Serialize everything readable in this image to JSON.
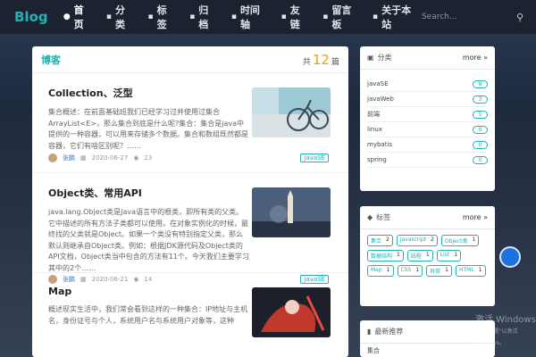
{
  "nav": {
    "logo": "Blog",
    "items": [
      {
        "label": "首页",
        "active": true
      },
      {
        "label": "分类"
      },
      {
        "label": "标签"
      },
      {
        "label": "归档"
      },
      {
        "label": "时间轴"
      },
      {
        "label": "友链"
      },
      {
        "label": "留言板"
      },
      {
        "label": "关于本站"
      }
    ],
    "search_placeholder": "Search..."
  },
  "main": {
    "title": "博客",
    "count_prefix": "共",
    "count": "12",
    "count_suffix": "篇",
    "articles": [
      {
        "title": "Collection、泛型",
        "desc": "集合概述：在前面基础班我们已经学习过并使用过集合ArrayList<E>，那么集合到底是什么呢?集合：集合是java中提供的一种容器，可以用来存储多个数据。集合和数组既然都是容器，它们有啥区别呢？……",
        "author": "张鹏",
        "date": "2020-06-27",
        "views": "23",
        "tag": "javaSE"
      },
      {
        "title": "Object类、常用API",
        "desc": "java.lang.Object类是Java语言中的根类，即所有类的父类。它中描述的所有方法子类都可以使用。在对象实例化的时候，最终找的父类就是Object。如果一个类没有特别指定父类，那么默认则继承自Object类。例如：根据JDK源代码及Object类的API文档，Object类当中包含的方法有11个。今天我们主要学习其中的2个……",
        "author": "张鹏",
        "date": "2020-06-21",
        "views": "14",
        "tag": "javaSE"
      },
      {
        "title": "Map",
        "desc": "概述现实生活中，我们常会看到这样的一种集合：IP地址与主机名，身份证号与个人，系统用户名与系统用户对象等，这种",
        "author": "",
        "date": "",
        "views": "",
        "tag": ""
      }
    ]
  },
  "categories": {
    "title": "分类",
    "more": "more",
    "items": [
      {
        "name": "javaSE",
        "count": "8"
      },
      {
        "name": "javaWeb",
        "count": "3"
      },
      {
        "name": "前端",
        "count": "5"
      },
      {
        "name": "linux",
        "count": "0"
      },
      {
        "name": "mybatis",
        "count": "0"
      },
      {
        "name": "spring",
        "count": "0"
      }
    ]
  },
  "tags": {
    "title": "标签",
    "more": "more",
    "items": [
      {
        "name": "集合",
        "count": "2"
      },
      {
        "name": "javascript",
        "count": "2"
      },
      {
        "name": "Object类",
        "count": "1"
      },
      {
        "name": "数据结构",
        "count": "1"
      },
      {
        "name": "线程",
        "count": "1"
      },
      {
        "name": "List",
        "count": "1"
      },
      {
        "name": "Map",
        "count": "1"
      },
      {
        "name": "CSS",
        "count": "1"
      },
      {
        "name": "异常",
        "count": "1"
      },
      {
        "name": "HTML",
        "count": "1"
      }
    ]
  },
  "recommend": {
    "title": "最新推荐",
    "first": "集合"
  },
  "watermark": {
    "line1": "激活 Windows",
    "line2": "转到\"设置\"以激活 Windows。"
  },
  "colors": {
    "accent": "#1fb3b3",
    "count": "#f39c12",
    "nav_bg": "#1b2330"
  }
}
